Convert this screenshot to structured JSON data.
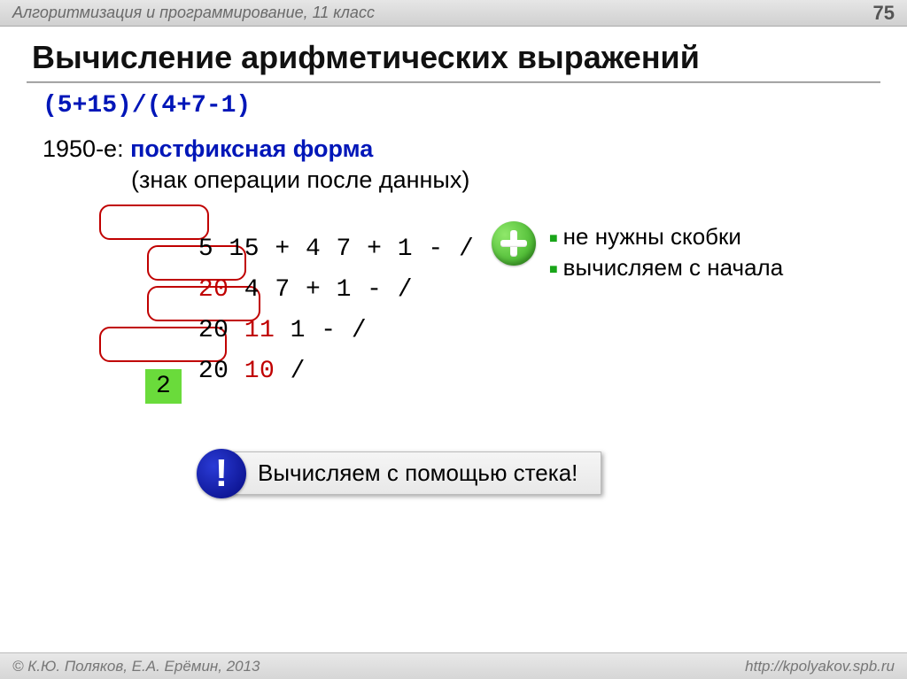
{
  "header": {
    "breadcrumb": "Алгоритмизация и программирование, 11 класс",
    "page_number": "75"
  },
  "title": "Вычисление арифметических выражений",
  "expression": "(5+15)/(4+7-1)",
  "year_line": {
    "prefix": "1950-е",
    "colon": ": ",
    "highlight": "постфиксная форма"
  },
  "sub_line": "(знак операции после данных)",
  "rows": {
    "r1": {
      "black": "5 15 + ",
      "tail": "4 7 + 1 - /"
    },
    "r2": {
      "red": "20 ",
      "black_mid": "4 7 + ",
      "tail": "1 - /"
    },
    "r3": {
      "lead": "20 ",
      "mid": "11 1 - ",
      "tail": "/"
    },
    "r4": {
      "lead": "20 ",
      "mid": "10 ",
      "tail": "/"
    },
    "result": "2"
  },
  "bullets": {
    "b1": "не нужны скобки",
    "b2": "вычисляем с начала"
  },
  "callout": {
    "badge": "!",
    "text": "Вычисляем с помощью стека!"
  },
  "footer": {
    "left": "© К.Ю. Поляков, Е.А. Ерёмин, 2013",
    "right": "http://kpolyakov.spb.ru"
  }
}
